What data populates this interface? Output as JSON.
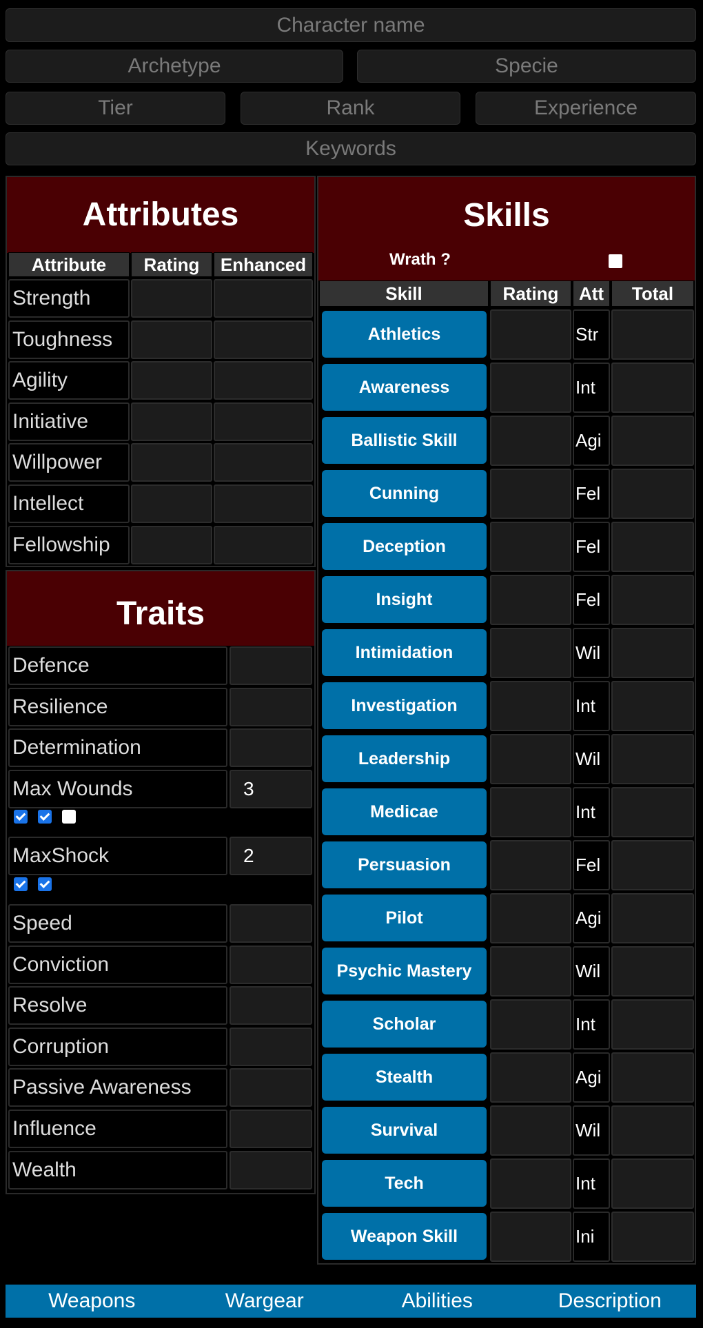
{
  "header": {
    "character_name_placeholder": "Character name",
    "archetype_placeholder": "Archetype",
    "specie_placeholder": "Specie",
    "tier_placeholder": "Tier",
    "rank_placeholder": "Rank",
    "experience_placeholder": "Experience",
    "keywords_placeholder": "Keywords"
  },
  "attributes": {
    "title": "Attributes",
    "columns": [
      "Attribute",
      "Rating",
      "Enhanced"
    ],
    "rows": [
      {
        "name": "Strength",
        "rating": "",
        "enhanced": ""
      },
      {
        "name": "Toughness",
        "rating": "",
        "enhanced": ""
      },
      {
        "name": "Agility",
        "rating": "",
        "enhanced": ""
      },
      {
        "name": "Initiative",
        "rating": "",
        "enhanced": ""
      },
      {
        "name": "Willpower",
        "rating": "",
        "enhanced": ""
      },
      {
        "name": "Intellect",
        "rating": "",
        "enhanced": ""
      },
      {
        "name": "Fellowship",
        "rating": "",
        "enhanced": ""
      }
    ]
  },
  "traits": {
    "title": "Traits",
    "rows": [
      {
        "name": "Defence",
        "value": ""
      },
      {
        "name": "Resilience",
        "value": ""
      },
      {
        "name": "Determination",
        "value": ""
      },
      {
        "name": "Max Wounds",
        "value": "3",
        "checkboxes": [
          true,
          true,
          false
        ]
      },
      {
        "name": "MaxShock",
        "value": "2",
        "checkboxes": [
          true,
          true
        ]
      },
      {
        "name": "Speed",
        "value": ""
      },
      {
        "name": "Conviction",
        "value": ""
      },
      {
        "name": "Resolve",
        "value": ""
      },
      {
        "name": "Corruption",
        "value": ""
      },
      {
        "name": "Passive Awareness",
        "value": ""
      },
      {
        "name": "Influence",
        "value": ""
      },
      {
        "name": "Wealth",
        "value": ""
      }
    ]
  },
  "skills": {
    "title": "Skills",
    "wrath_label": "Wrath ?",
    "wrath_checked": false,
    "columns": [
      "Skill",
      "Rating",
      "Att",
      "Total"
    ],
    "rows": [
      {
        "name": "Athletics",
        "att": "Str"
      },
      {
        "name": "Awareness",
        "att": "Int"
      },
      {
        "name": "Ballistic Skill",
        "att": "Agi"
      },
      {
        "name": "Cunning",
        "att": "Fel"
      },
      {
        "name": "Deception",
        "att": "Fel"
      },
      {
        "name": "Insight",
        "att": "Fel"
      },
      {
        "name": "Intimidation",
        "att": "Wil"
      },
      {
        "name": "Investigation",
        "att": "Int"
      },
      {
        "name": "Leadership",
        "att": "Wil"
      },
      {
        "name": "Medicae",
        "att": "Int"
      },
      {
        "name": "Persuasion",
        "att": "Fel"
      },
      {
        "name": "Pilot",
        "att": "Agi"
      },
      {
        "name": "Psychic Mastery",
        "att": "Wil"
      },
      {
        "name": "Scholar",
        "att": "Int"
      },
      {
        "name": "Stealth",
        "att": "Agi"
      },
      {
        "name": "Survival",
        "att": "Wil"
      },
      {
        "name": "Tech",
        "att": "Int"
      },
      {
        "name": "Weapon Skill",
        "att": "Ini"
      }
    ]
  },
  "nav": {
    "tabs": [
      "Weapons",
      "Wargear",
      "Abilities",
      "Description"
    ]
  },
  "colors": {
    "panel_header": "#4a0003",
    "skill_button": "#0070a8",
    "nav_bar": "#0070a8"
  }
}
